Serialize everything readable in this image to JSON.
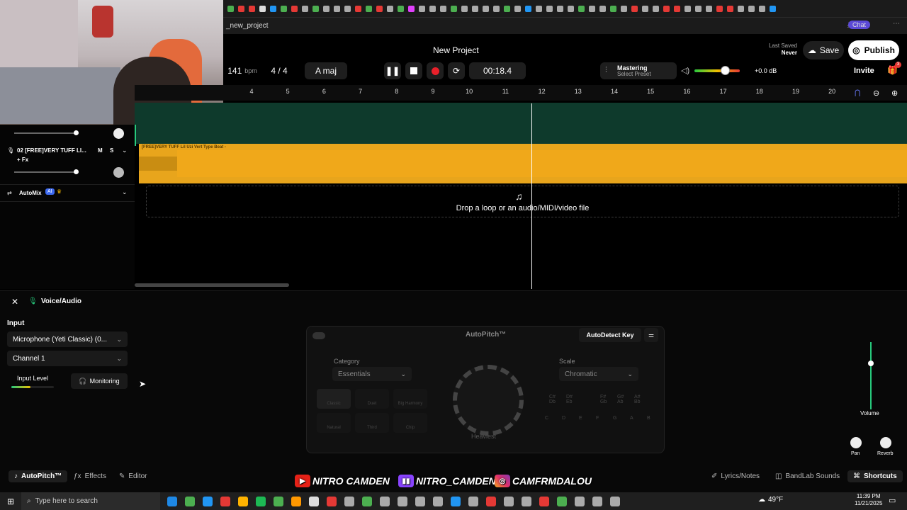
{
  "browser": {
    "address_text": "_new_project",
    "tab_colors": [
      "#4caf50",
      "#e53935",
      "#e53935",
      "#ddd",
      "#2196f3",
      "#4caf50",
      "#e53935",
      "#aaa",
      "#4caf50",
      "#aaa",
      "#aaa",
      "#aaa",
      "#e53935",
      "#4caf50",
      "#e53935",
      "#aaa",
      "#4caf50",
      "#e040fb",
      "#aaa",
      "#aaa",
      "#aaa",
      "#4caf50",
      "#aaa",
      "#aaa",
      "#aaa",
      "#aaa",
      "#4caf50",
      "#aaa",
      "#2196f3",
      "#aaa",
      "#aaa",
      "#aaa",
      "#aaa",
      "#4caf50",
      "#aaa",
      "#aaa",
      "#4caf50",
      "#aaa",
      "#e53935",
      "#aaa",
      "#aaa",
      "#e53935",
      "#e53935",
      "#aaa",
      "#aaa",
      "#aaa",
      "#e53935",
      "#e53935",
      "#aaa",
      "#aaa",
      "#aaa",
      "#2196f3"
    ],
    "chat_label": "Chat"
  },
  "header": {
    "title": "New Project",
    "bpm_value": "141",
    "bpm_unit": "bpm",
    "time_sig": "4 / 4",
    "key": "A maj",
    "time": "00:18.4",
    "mastering_label": "Mastering",
    "mastering_preset": "Select Preset",
    "volume_db": "+0.0 dB",
    "last_saved_label": "Last Saved",
    "last_saved_value": "Never",
    "save_label": "Save",
    "publish_label": "Publish",
    "invite_label": "Invite",
    "notif_count": "3"
  },
  "ruler": [
    "4",
    "5",
    "6",
    "7",
    "8",
    "9",
    "10",
    "11",
    "12",
    "13",
    "14",
    "15",
    "16",
    "17",
    "18",
    "19",
    "20"
  ],
  "tracks": {
    "track2_name": "02  [FREE]VERY TUFF LI...",
    "track2_mute": "M",
    "track2_solo": "S",
    "track2_fx": "+ Fx",
    "track2_region": "[FREE]VERY TUFF Lil Uzi Vert Type Beat -",
    "automix": "AutoMix",
    "ai_badge": "AI"
  },
  "drop_zone": "Drop a loop or an audio/MIDI/video file",
  "bottom": {
    "panel_title": "Voice/Audio",
    "input_label": "Input",
    "input_device": "Microphone (Yeti Classic) (0...",
    "channel": "Channel 1",
    "input_level_label": "Input Level",
    "input_level": 0.45,
    "monitoring_label": "Monitoring",
    "autopitch_title": "AutoPitch™",
    "autodetect_label": "AutoDetect Key",
    "category_label": "Category",
    "category_value": "Essentials",
    "scale_label": "Scale",
    "scale_value": "Chromatic",
    "knob_label": "Heaviest",
    "pads": [
      "Classic",
      "Duet",
      "Big Harmony",
      "Natural",
      "Third",
      "Chip"
    ],
    "notes": [
      "C",
      "D",
      "E",
      "F",
      "G",
      "A",
      "B"
    ],
    "accidentals": [
      "C#\nDb",
      "D#\nEb",
      "F#\nGb",
      "G#\nAb",
      "A#\nBb"
    ],
    "volume_label": "Volume",
    "pan_label": "Pan",
    "reverb_label": "Reverb"
  },
  "footer": {
    "autopitch_tab": "AutoPitch™",
    "effects_tab": "Effects",
    "editor_tab": "Editor",
    "lyrics_tab": "Lyrics/Notes",
    "bandlab_tab": "BandLab Sounds",
    "shortcuts_tab": "Shortcuts"
  },
  "overlay": {
    "youtube": "NITRO CAMDEN",
    "twitch": "NITRO_CAMDEN",
    "instagram": "CAMFRMDALOU"
  },
  "taskbar": {
    "search_placeholder": "Type here to search",
    "weather": "49°F",
    "time": "11:39 PM",
    "date": "11/21/2025",
    "icon_colors": [
      "#1e88e5",
      "#4caf50",
      "#2196f3",
      "#e53935",
      "#ffb300",
      "#1db954",
      "#4caf50",
      "#ff9800",
      "#ddd",
      "#e53935",
      "#aaa",
      "#4caf50",
      "#aaa",
      "#aaa",
      "#aaa",
      "#aaa",
      "#2196f3",
      "#aaa",
      "#e53935",
      "#aaa",
      "#aaa",
      "#e53935",
      "#4caf50",
      "#aaa",
      "#aaa",
      "#aaa"
    ]
  }
}
